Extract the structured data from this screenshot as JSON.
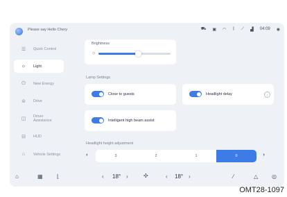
{
  "topbar": {
    "assistant_prompt": "Please say Hello Chery",
    "time": "04:09",
    "icons": [
      "car-icon",
      "camera-icon",
      "wifi-icon",
      "bluetooth-icon",
      "signal-off-icon",
      "signal-icon",
      "account-icon"
    ]
  },
  "sidebar": {
    "items": [
      {
        "label": "Quick Control",
        "icon": "quick-control-icon",
        "active": false
      },
      {
        "label": "Light",
        "icon": "light-icon",
        "active": true
      },
      {
        "label": "New Energy",
        "icon": "energy-icon",
        "active": false
      },
      {
        "label": "Drive",
        "icon": "drive-icon",
        "active": false
      },
      {
        "label": "Driver Assistance",
        "icon": "driver-assistance-icon",
        "active": false
      },
      {
        "label": "HUD",
        "icon": "hud-icon",
        "active": false
      },
      {
        "label": "Vehicle Settings",
        "icon": "vehicle-settings-icon",
        "active": false
      }
    ]
  },
  "brightness": {
    "label": "Brightness",
    "level_fraction": 0.55
  },
  "lamp_settings": {
    "title": "Lamp Settings",
    "close_to_guests": {
      "label": "Close to guests",
      "on": true
    },
    "headlight_delay": {
      "label": "Headlight delay",
      "on": true
    },
    "high_beam_assist": {
      "label": "Intelligent high beam assist",
      "on": true
    }
  },
  "headlight_height": {
    "title": "Headlight height adjustment",
    "options": [
      "3",
      "2",
      "1",
      "0"
    ],
    "selected": "0"
  },
  "bottombar": {
    "temp_left": "18",
    "temp_right": "18",
    "temp_unit": "°",
    "prev_left": "‹",
    "next_left": "›",
    "prev_right": "‹",
    "next_right": "›"
  },
  "caption": "OMT28-1097",
  "colors": {
    "accent": "#3d7be6",
    "screen_bg": "#eef1f6",
    "card_bg": "#ffffff"
  }
}
